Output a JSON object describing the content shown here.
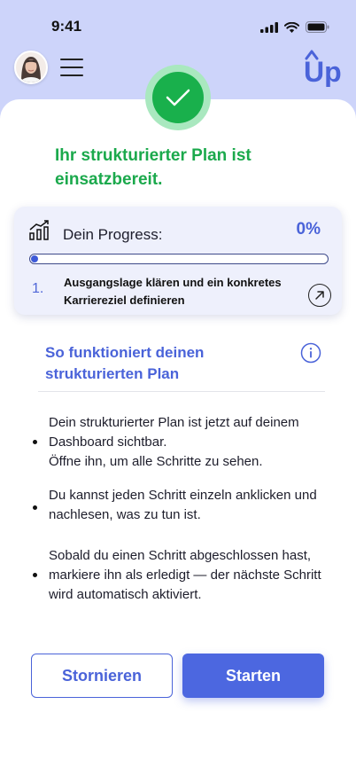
{
  "status_bar": {
    "time": "9:41"
  },
  "header": {
    "avatar_icon": "user-avatar",
    "menu_icon": "hamburger-icon",
    "logo_text": "Up",
    "logo_color": "#4a63d9"
  },
  "success": {
    "icon": "checkmark-icon",
    "title": "Ihr strukturierter Plan ist einsatzbereit."
  },
  "progress": {
    "icon": "bar-chart-icon",
    "label": "Dein Progress:",
    "percent_text": "0%",
    "percent_value": 0,
    "step_number": "1.",
    "step_text": "Ausgangslage klären und ein konkretes Karriereziel definieren",
    "step_link_icon": "arrow-up-right-icon"
  },
  "how_it_works": {
    "title": "So funktioniert  deinen strukturierten Plan",
    "info_icon": "info-icon",
    "bullets": [
      "Dein strukturierter Plan ist jetzt auf deinem Dashboard sichtbar.\nÖffne ihn, um alle Schritte zu sehen.",
      "Du kannst jeden Schritt einzeln anklicken und nachlesen, was zu tun ist.",
      "Sobald du einen Schritt abgeschlossen hast, markiere ihn als erledigt — der nächste Schritt wird automatisch aktiviert."
    ]
  },
  "actions": {
    "cancel_label": "Stornieren",
    "start_label": "Starten"
  },
  "colors": {
    "header_bg": "#cdd4fa",
    "accent": "#4a63d9",
    "success": "#19b04c",
    "success_halo": "#a9e8bf",
    "card_bg": "#eef0fc"
  }
}
